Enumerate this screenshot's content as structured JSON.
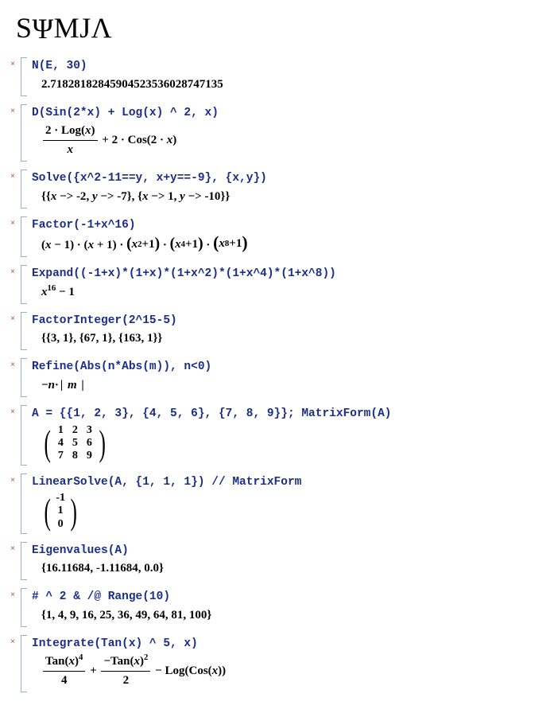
{
  "brand": "SΨMJΛ",
  "close_glyph": "×",
  "cells": [
    {
      "input": "N(E, 30)",
      "output_plain": "2.71828182845904523536028747135"
    },
    {
      "input": "D(Sin(2*x) + Log(x) ^ 2, x)",
      "output_math": "frac_2logx_over_x_plus_2cos2x"
    },
    {
      "input": "Solve({x^2-11==y, x+y==-9}, {x,y})",
      "output_math": "solve_result"
    },
    {
      "input": "Factor(-1+x^16)",
      "output_math": "factor_result"
    },
    {
      "input": "Expand((-1+x)*(1+x)*(1+x^2)*(1+x^4)*(1+x^8))",
      "output_math": "x16_minus_1"
    },
    {
      "input": "FactorInteger(2^15-5)",
      "output_plain": "{{3, 1}, {67, 1}, {163, 1}}"
    },
    {
      "input": "Refine(Abs(n*Abs(m)), n<0)",
      "output_math": "refine_result"
    },
    {
      "input": "A = {{1, 2, 3}, {4, 5, 6}, {7, 8, 9}}; MatrixForm(A)",
      "output_math": "matrix_3x3"
    },
    {
      "input": "LinearSolve(A, {1, 1, 1}) // MatrixForm",
      "output_math": "matrix_3x1"
    },
    {
      "input": "Eigenvalues(A)",
      "output_plain": "{16.11684, -1.11684, 0.0}"
    },
    {
      "input": "# ^ 2 & /@ Range(10)",
      "output_plain": "{1, 4, 9, 16, 25, 36, 49, 64, 81, 100}"
    },
    {
      "input": "Integrate(Tan(x) ^ 5, x)",
      "output_math": "integrate_result"
    }
  ],
  "matrix_3x3": [
    [
      1,
      2,
      3
    ],
    [
      4,
      5,
      6
    ],
    [
      7,
      8,
      9
    ]
  ],
  "matrix_3x1": [
    -1,
    1,
    0
  ]
}
